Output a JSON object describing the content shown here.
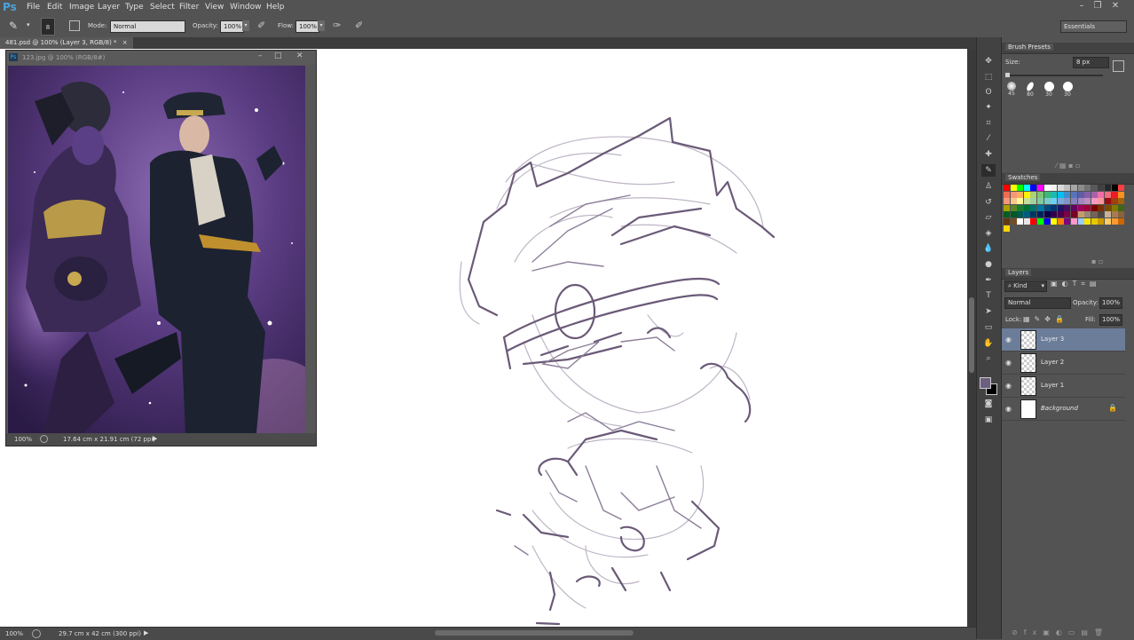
{
  "app": {
    "logo": "Ps"
  },
  "menu": [
    "File",
    "Edit",
    "Image",
    "Layer",
    "Type",
    "Select",
    "Filter",
    "View",
    "Window",
    "Help"
  ],
  "options": {
    "brush_size": "8",
    "mode_label": "Mode:",
    "mode_value": "Normal",
    "opacity_label": "Opacity:",
    "opacity_value": "100%",
    "flow_label": "Flow:",
    "flow_value": "100%",
    "workspace": "Essentials"
  },
  "document": {
    "tab": "481.psd @ 100% (Layer 3, RGB/8) *",
    "zoom": "100%",
    "size_info": "29.7 cm x 42 cm (300 ppi)"
  },
  "float_window": {
    "title": "123.jpg @ 100% (RGB/8#)",
    "zoom": "100%",
    "size_info": "17.64 cm x 21.91 cm (72 ppi)"
  },
  "brush_presets": {
    "title": "Brush Presets",
    "size_label": "Size:",
    "size_value": "8 px",
    "presets": [
      "45",
      "80",
      "30",
      "30"
    ]
  },
  "swatches": {
    "title": "Swatches",
    "colors": [
      "#ff0000",
      "#ffff00",
      "#00ff00",
      "#00ffff",
      "#0000ff",
      "#ff00ff",
      "#ffffff",
      "#f2f2f2",
      "#d9d9d9",
      "#bfbfbf",
      "#a6a6a6",
      "#8c8c8c",
      "#737373",
      "#595959",
      "#404040",
      "#262626",
      "#000000",
      "#ff4040",
      "#f26c4f",
      "#f69679",
      "#fbaf5d",
      "#fff200",
      "#acd373",
      "#7cc576",
      "#3bb878",
      "#1abbb4",
      "#00bff3",
      "#438ccb",
      "#5574b9",
      "#605ca8",
      "#855fa8",
      "#a763a8",
      "#f06ea9",
      "#f26d7d",
      "#ed1c24",
      "#f7941d",
      "#f7977a",
      "#fdc689",
      "#fff799",
      "#c4df9b",
      "#a3d39c",
      "#82ca9d",
      "#7accc8",
      "#6dcff6",
      "#7da7d9",
      "#8393ca",
      "#8781bd",
      "#a187be",
      "#bc8dbf",
      "#f49ac2",
      "#f6989d",
      "#9e0b0f",
      "#a0410d",
      "#a36209",
      "#aba000",
      "#598527",
      "#1a7b30",
      "#007236",
      "#00746b",
      "#0076a3",
      "#004b80",
      "#003471",
      "#1b1464",
      "#440e62",
      "#630460",
      "#9e005d",
      "#9e0039",
      "#790000",
      "#7b2e00",
      "#7d4900",
      "#827b00",
      "#406618",
      "#005e20",
      "#005826",
      "#005952",
      "#005b7f",
      "#003663",
      "#002157",
      "#0d004c",
      "#32004b",
      "#4b0049",
      "#7b0046",
      "#7a0026",
      "#c69c6d",
      "#998675",
      "#736357",
      "#534741",
      "#c7b299",
      "#a67c52",
      "#8c6239",
      "#603813",
      "#754c24",
      "#ffffff",
      "#e6e6e6",
      "#ff0000",
      "#00ff00",
      "#0000ff",
      "#ffff00",
      "#ff8000",
      "#800080",
      "#ff99cc",
      "#99ccff",
      "#ffe600",
      "#e6c800",
      "#cc9900",
      "#ffcc66",
      "#ff9933",
      "#cc6600"
    ],
    "extra": [
      "#ffd700"
    ]
  },
  "layers_panel": {
    "title": "Layers",
    "kind_label": "Kind",
    "blend_value": "Normal",
    "opacity_label": "Opacity:",
    "opacity_value": "100%",
    "lock_label": "Lock:",
    "fill_label": "Fill:",
    "fill_value": "100%",
    "layers": [
      {
        "name": "Layer 3",
        "selected": true
      },
      {
        "name": "Layer 2",
        "selected": false
      },
      {
        "name": "Layer 1",
        "selected": false
      },
      {
        "name": "Background",
        "selected": false,
        "locked": true
      }
    ]
  },
  "colors": {
    "foreground": "#6b6080",
    "background": "#000000",
    "sketch_stroke": "#6a5a78"
  }
}
